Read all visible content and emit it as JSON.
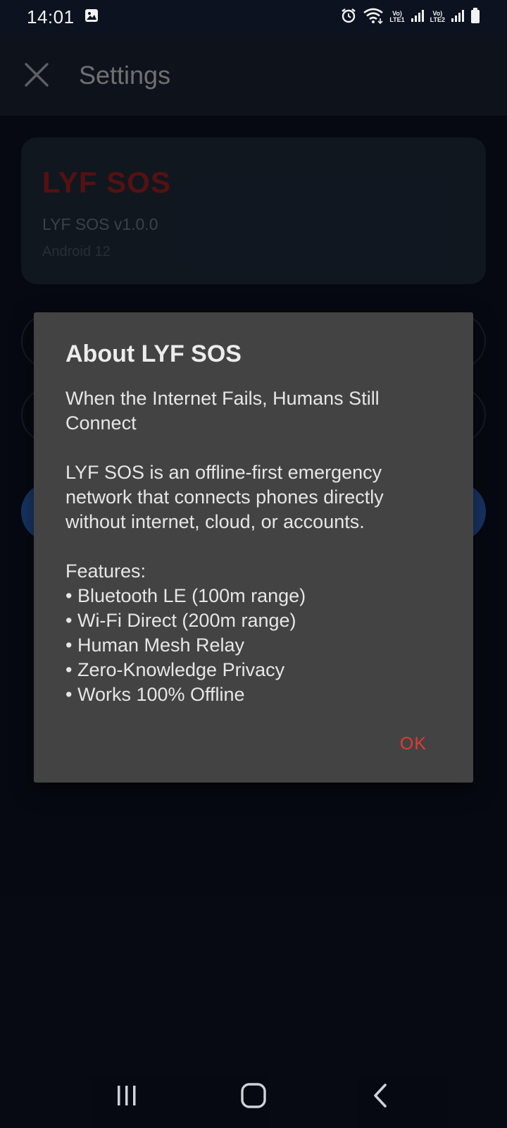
{
  "status_bar": {
    "time": "14:01",
    "sim1_label_top": "Vo)",
    "sim1_label_bottom": "LTE1",
    "sim2_label_top": "Vo)",
    "sim2_label_bottom": "LTE2",
    "icons": [
      "gallery-icon",
      "alarm-icon",
      "wifi-icon",
      "signal-icon",
      "battery-icon"
    ]
  },
  "app_bar": {
    "title": "Settings"
  },
  "info_card": {
    "brand": "LYF SOS",
    "version": "LYF SOS v1.0.0",
    "os": "Android 12"
  },
  "dialog": {
    "title": "About LYF SOS",
    "body": "When the Internet Fails, Humans Still Connect\n\nLYF SOS is an offline-first emergency network that connects phones directly without internet, cloud, or accounts.\n\nFeatures:\n• Bluetooth LE (100m range)\n• Wi-Fi Direct (200m range)\n• Human Mesh Relay\n• Zero-Knowledge Privacy\n• Works 100% Offline",
    "ok_label": "OK"
  },
  "colors": {
    "background": "#0c1220",
    "app_bar": "#1a2232",
    "brand_red": "#9b1f1f",
    "dialog_bg": "#434343",
    "ok_red": "#e53935",
    "accent_blue": "#2d5fb8"
  }
}
